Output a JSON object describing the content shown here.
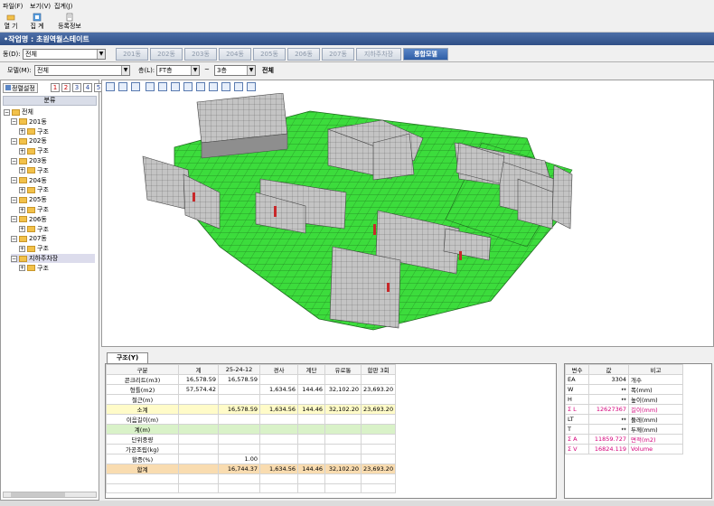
{
  "menu": [
    "파일(F)",
    "보기(V)",
    "집계(J)"
  ],
  "toolbar": {
    "open": "열 기",
    "aggregate": "집 계",
    "register": "등록정보"
  },
  "work_title": "•작업명 : 초원역월스테이트",
  "building_label": "동(D):",
  "building_value": "전체",
  "tabs": [
    "201동",
    "202동",
    "203동",
    "204동",
    "205동",
    "206동",
    "207동",
    "지하주차장",
    "통합모델"
  ],
  "active_tab_index": 8,
  "model_label": "모델(M):",
  "model_value": "전체",
  "floor_label": "층(L):",
  "floor_from": "FT층",
  "floor_tilde": "~",
  "floor_to": "3층",
  "floor_all": "전체",
  "left": {
    "sort_button": "정렬설정",
    "num_buttons": [
      "1",
      "2",
      "3",
      "4",
      "5"
    ],
    "tree_header": "분류",
    "root": "전체",
    "items": [
      {
        "label": "201동",
        "child": "구조"
      },
      {
        "label": "202동",
        "child": "구조"
      },
      {
        "label": "203동",
        "child": "구조"
      },
      {
        "label": "204동",
        "child": "구조"
      },
      {
        "label": "205동",
        "child": "구조"
      },
      {
        "label": "206동",
        "child": "구조"
      },
      {
        "label": "207동",
        "child": "구조"
      },
      {
        "label": "지하주차장",
        "child": "구조"
      }
    ]
  },
  "bottom_tab": "구조(Y)",
  "table": {
    "headers": [
      "구분",
      "계",
      "25-24-12",
      "경사",
      "계단",
      "유로통",
      "합판 3회"
    ],
    "rows": [
      {
        "type": "",
        "cells": [
          "콘크리트(m3)",
          "16,578.59",
          "16,578.59",
          "",
          "",
          "",
          ""
        ]
      },
      {
        "type": "",
        "cells": [
          "형틀(m2)",
          "57,574.42",
          "",
          "1,634.56",
          "144.46",
          "32,102.20",
          "23,693.20"
        ]
      },
      {
        "type": "",
        "cells": [
          "철근(m)",
          "",
          "",
          "",
          "",
          "",
          ""
        ]
      },
      {
        "type": "yel",
        "cells": [
          "소계",
          "",
          "16,578.59",
          "1,634.56",
          "144.46",
          "32,102.20",
          "23,693.20"
        ]
      },
      {
        "type": "",
        "cells": [
          "이음길이(m)",
          "",
          "",
          "",
          "",
          "",
          ""
        ]
      },
      {
        "type": "grn",
        "cells": [
          "계(m)",
          "",
          "",
          "",
          "",
          "",
          ""
        ]
      },
      {
        "type": "",
        "cells": [
          "단위중량",
          "",
          "",
          "",
          "",
          "",
          ""
        ]
      },
      {
        "type": "",
        "cells": [
          "가공조립(kg)",
          "",
          "",
          "",
          "",
          "",
          ""
        ]
      },
      {
        "type": "",
        "cells": [
          "할증(%)",
          "",
          "1.00",
          "",
          "",
          "",
          ""
        ]
      },
      {
        "type": "org",
        "cells": [
          "합계",
          "",
          "16,744.37",
          "1,634.56",
          "144.46",
          "32,102.20",
          "23,693.20"
        ]
      }
    ]
  },
  "right_table": {
    "headers": [
      "변수",
      "값",
      "비고"
    ],
    "rows": [
      {
        "pink": false,
        "cells": [
          "EA",
          "3304",
          "개수"
        ]
      },
      {
        "pink": false,
        "cells": [
          "W",
          "↔",
          "폭(mm)"
        ]
      },
      {
        "pink": false,
        "cells": [
          "H",
          "↔",
          "높이(mm)"
        ]
      },
      {
        "pink": true,
        "cells": [
          "Σ L",
          "12627367",
          "길이(mm)"
        ]
      },
      {
        "pink": false,
        "cells": [
          "LT",
          "↔",
          "둘레(mm)"
        ]
      },
      {
        "pink": false,
        "cells": [
          "T",
          "↔",
          "두께(mm)"
        ]
      },
      {
        "pink": true,
        "cells": [
          "Σ A",
          "11859.727",
          "면적(m2)"
        ]
      },
      {
        "pink": true,
        "cells": [
          "Σ V",
          "16824.119",
          "Volume"
        ]
      }
    ]
  },
  "colors": {
    "slab": "#3cdc3c",
    "building": "#c0c0c0",
    "accent": "#2f5ea6"
  }
}
